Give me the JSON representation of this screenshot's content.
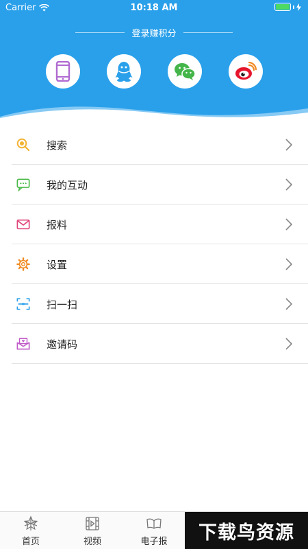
{
  "status_bar": {
    "carrier": "Carrier",
    "time": "10:18 AM"
  },
  "header": {
    "login_title": "登录赚积分",
    "socials": [
      {
        "icon": "phone-icon",
        "color": "#b06ad1"
      },
      {
        "icon": "qq-icon",
        "color": "#2aa0ea"
      },
      {
        "icon": "wechat-icon",
        "color": "#44b549"
      },
      {
        "icon": "weibo-icon",
        "color": "#e6162d"
      }
    ]
  },
  "menu": {
    "items": [
      {
        "label": "搜索",
        "icon": "search-icon",
        "color": "#f2b230"
      },
      {
        "label": "我的互动",
        "icon": "chat-icon",
        "color": "#4cbb4a"
      },
      {
        "label": "报料",
        "icon": "mail-icon",
        "color": "#e0467a"
      },
      {
        "label": "设置",
        "icon": "gear-icon",
        "color": "#f08a24"
      },
      {
        "label": "扫一扫",
        "icon": "scan-icon",
        "color": "#2aa0ea"
      },
      {
        "label": "邀请码",
        "icon": "invite-icon",
        "color": "#c15bc9"
      }
    ]
  },
  "tabbar": {
    "tabs": [
      {
        "label": "首页",
        "icon": "home-star-icon"
      },
      {
        "label": "视频",
        "icon": "video-icon"
      },
      {
        "label": "电子报",
        "icon": "book-icon"
      }
    ],
    "watermark": "下载鸟资源"
  }
}
